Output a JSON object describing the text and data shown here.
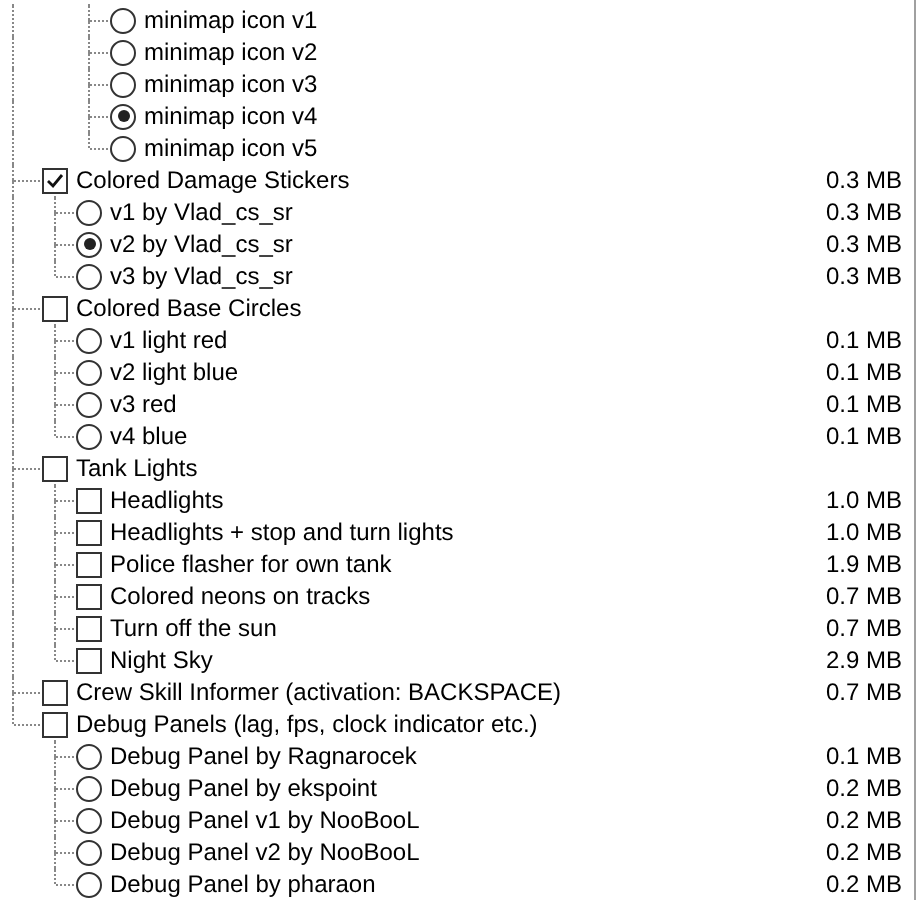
{
  "tree": [
    {
      "kind": "cut",
      "children": [
        {
          "kind": "cut",
          "children": [
            {
              "kind": "radio",
              "label": "minimap icon v1",
              "selected": false
            },
            {
              "kind": "radio",
              "label": "minimap icon v2",
              "selected": false
            },
            {
              "kind": "radio",
              "label": "minimap icon v3",
              "selected": false
            },
            {
              "kind": "radio",
              "label": "minimap icon v4",
              "selected": true
            },
            {
              "kind": "radio",
              "label": "minimap icon v5",
              "selected": false
            }
          ]
        }
      ]
    },
    {
      "kind": "checkbox",
      "label": "Colored Damage Stickers",
      "checked": true,
      "size": "0.3 MB",
      "children": [
        {
          "kind": "radio",
          "label": "v1 by Vlad_cs_sr",
          "selected": false,
          "size": "0.3 MB"
        },
        {
          "kind": "radio",
          "label": "v2 by Vlad_cs_sr",
          "selected": true,
          "size": "0.3 MB"
        },
        {
          "kind": "radio",
          "label": "v3 by Vlad_cs_sr",
          "selected": false,
          "size": "0.3 MB"
        }
      ]
    },
    {
      "kind": "checkbox",
      "label": "Colored Base Circles",
      "checked": false,
      "children": [
        {
          "kind": "radio",
          "label": "v1 light red",
          "selected": false,
          "size": "0.1 MB"
        },
        {
          "kind": "radio",
          "label": "v2 light blue",
          "selected": false,
          "size": "0.1 MB"
        },
        {
          "kind": "radio",
          "label": "v3 red",
          "selected": false,
          "size": "0.1 MB"
        },
        {
          "kind": "radio",
          "label": "v4 blue",
          "selected": false,
          "size": "0.1 MB"
        }
      ]
    },
    {
      "kind": "checkbox",
      "label": "Tank Lights",
      "checked": false,
      "children": [
        {
          "kind": "checkbox",
          "label": "Headlights",
          "checked": false,
          "size": "1.0 MB"
        },
        {
          "kind": "checkbox",
          "label": "Headlights + stop and turn lights",
          "checked": false,
          "size": "1.0 MB"
        },
        {
          "kind": "checkbox",
          "label": "Police flasher for own tank",
          "checked": false,
          "size": "1.9 MB"
        },
        {
          "kind": "checkbox",
          "label": "Colored neons on tracks",
          "checked": false,
          "size": "0.7 MB"
        },
        {
          "kind": "checkbox",
          "label": "Turn off the sun",
          "checked": false,
          "size": "0.7 MB"
        },
        {
          "kind": "checkbox",
          "label": "Night Sky",
          "checked": false,
          "size": "2.9 MB"
        }
      ]
    },
    {
      "kind": "checkbox",
      "label": "Crew Skill Informer (activation: BACKSPACE)",
      "checked": false,
      "size": "0.7 MB"
    },
    {
      "kind": "checkbox",
      "label": "Debug Panels (lag, fps, clock indicator etc.)",
      "checked": false,
      "children": [
        {
          "kind": "radio",
          "label": "Debug Panel by Ragnarocek",
          "selected": false,
          "size": "0.1 MB"
        },
        {
          "kind": "radio",
          "label": "Debug Panel by ekspoint",
          "selected": false,
          "size": "0.2 MB"
        },
        {
          "kind": "radio",
          "label": "Debug Panel v1 by NooBooL",
          "selected": false,
          "size": "0.2 MB"
        },
        {
          "kind": "radio",
          "label": "Debug Panel v2 by NooBooL",
          "selected": false,
          "size": "0.2 MB"
        },
        {
          "kind": "radio",
          "label": "Debug Panel by pharaon",
          "selected": false,
          "size": "0.2 MB"
        }
      ]
    }
  ]
}
